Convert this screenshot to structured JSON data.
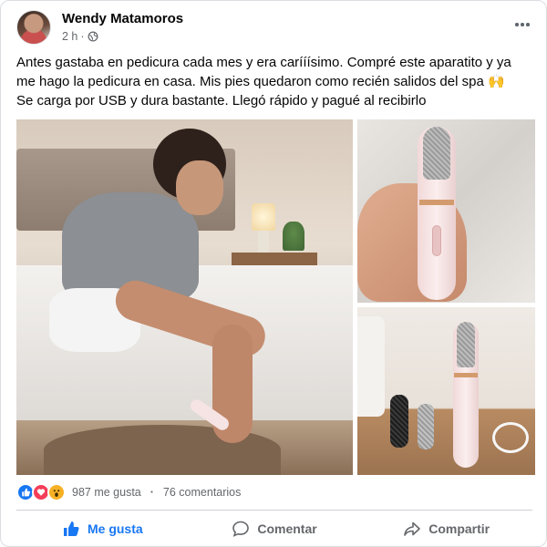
{
  "post": {
    "author": "Wendy Matamoros",
    "time": "2 h",
    "separator": "·",
    "text_lines": [
      "Antes gastaba en pedicura cada mes y era carííísimo. Compré este aparatito y ya",
      "me hago la pedicura en casa. Mis pies quedaron como recién salidos del spa 🙌",
      "Se carga por USB y dura bastante. Llegó rápido y pagué al recibirlo"
    ]
  },
  "icons": {
    "avatar": "avatar-photo",
    "privacy": "globe-icon",
    "more": "more-options-icon",
    "reactions": [
      "like-reaction-icon",
      "love-reaction-icon",
      "wow-reaction-icon"
    ]
  },
  "engagement": {
    "likes": "987 me gusta",
    "dot": "·",
    "comments": "76 comentarios"
  },
  "actions": {
    "like": "Me gusta",
    "comment": "Comentar",
    "share": "Compartir"
  },
  "colors": {
    "accent": "#1877f2",
    "secondary_text": "#65676b",
    "love": "#f33e58",
    "wow": "#f7b125"
  }
}
